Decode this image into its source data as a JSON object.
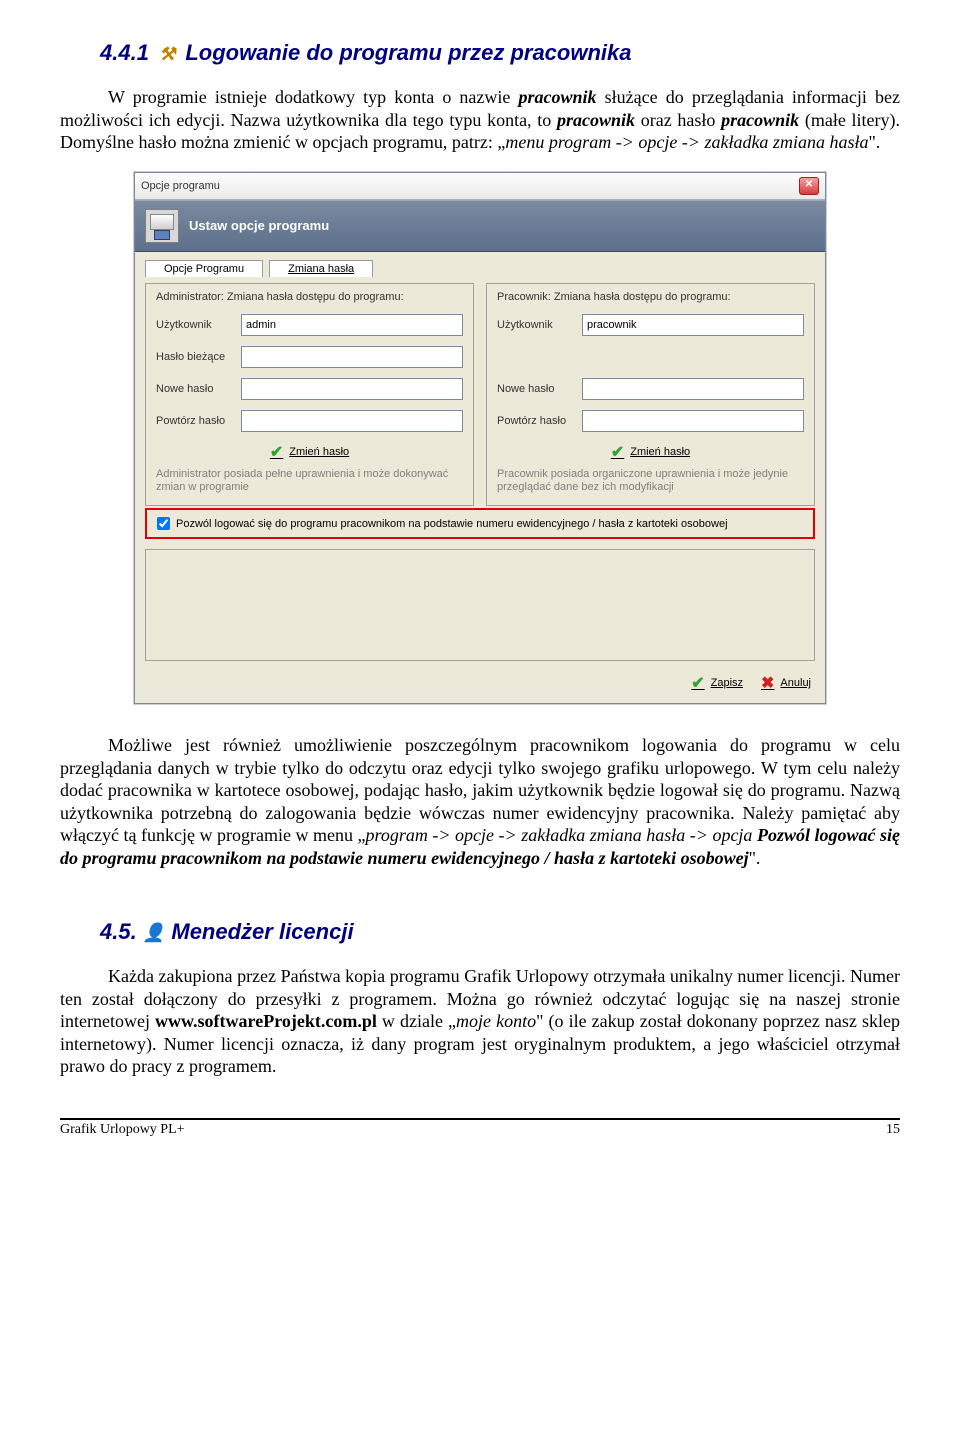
{
  "section1": {
    "number": "4.4.1",
    "title": "Logowanie do programu przez pracownika"
  },
  "p1_a": "W programie istnieje dodatkowy typ konta o nazwie ",
  "p1_b": "pracownik",
  "p1_c": " służące do przeglądania informacji bez możliwości ich edycji. Nazwa użytkownika dla tego typu konta, to ",
  "p1_d": "pracownik",
  "p1_e": " oraz hasło ",
  "p1_f": "pracownik",
  "p1_g": " (małe litery). Domyślne hasło można zmienić w opcjach programu, patrz: „",
  "p1_h": "menu program -> opcje -> zakładka zmiana hasła",
  "p1_i": "\".",
  "dialog": {
    "window_title": "Opcje programu",
    "ribbon_title": "Ustaw opcje programu",
    "tab1": "Opcje Programu",
    "tab2": "Zmiana hasła",
    "left": {
      "title": "Administrator: Zmiana hasła dostępu do programu:",
      "user_label": "Użytkownik",
      "user_value": "admin",
      "curpwd_label": "Hasło bieżące",
      "newpwd_label": "Nowe hasło",
      "reppwd_label": "Powtórz hasło",
      "action": "Zmień hasło",
      "note": "Administrator posiada pełne uprawnienia i może dokonywać zmian w programie"
    },
    "right": {
      "title": "Pracownik: Zmiana hasła dostępu do programu:",
      "user_label": "Użytkownik",
      "user_value": "pracownik",
      "newpwd_label": "Nowe hasło",
      "reppwd_label": "Powtórz hasło",
      "action": "Zmień hasło",
      "note": "Pracownik posiada organiczone uprawnienia i może jedynie przeglądać dane bez ich modyfikacji"
    },
    "redbox": "Pozwól logować się do programu pracownikom na podstawie numeru ewidencyjnego / hasła z kartoteki osobowej",
    "save": "Zapisz",
    "cancel": "Anuluj"
  },
  "p2_a": "Możliwe jest również umożliwienie poszczególnym pracownikom logowania do programu w celu przeglądania danych w trybie tylko do odczytu oraz edycji tylko swojego grafiku urlopowego. W tym celu należy dodać pracownika w kartotece osobowej, podając hasło, jakim użytkownik będzie logował się do programu. Nazwą użytkownika potrzebną do zalogowania będzie wówczas numer ewidencyjny pracownika. Należy pamiętać aby włączyć tą funkcję w programie w menu „",
  "p2_b": "program -> opcje -> zakładka zmiana hasła -> opcja ",
  "p2_c": "Pozwól logować się do programu pracownikom na podstawie numeru ewidencyjnego / hasła z kartoteki osobowej",
  "p2_d": "\".",
  "section2": {
    "number": "4.5.",
    "title": "Menedżer licencji"
  },
  "p3_a": "Każda zakupiona przez Państwa kopia programu Grafik Urlopowy otrzymała unikalny numer licencji. Numer ten został dołączony do przesyłki z programem. Można go również odczytać logując się na naszej stronie internetowej ",
  "p3_b": "www.softwareProjekt.com.pl",
  "p3_c": " w dziale „",
  "p3_d": "moje konto",
  "p3_e": "\" (o ile zakup został dokonany poprzez nasz sklep internetowy). Numer licencji oznacza, iż dany program jest oryginalnym produktem, a jego właściciel otrzymał prawo do pracy z programem.",
  "footer": {
    "left": "Grafik Urlopowy PL+",
    "right": "15"
  }
}
